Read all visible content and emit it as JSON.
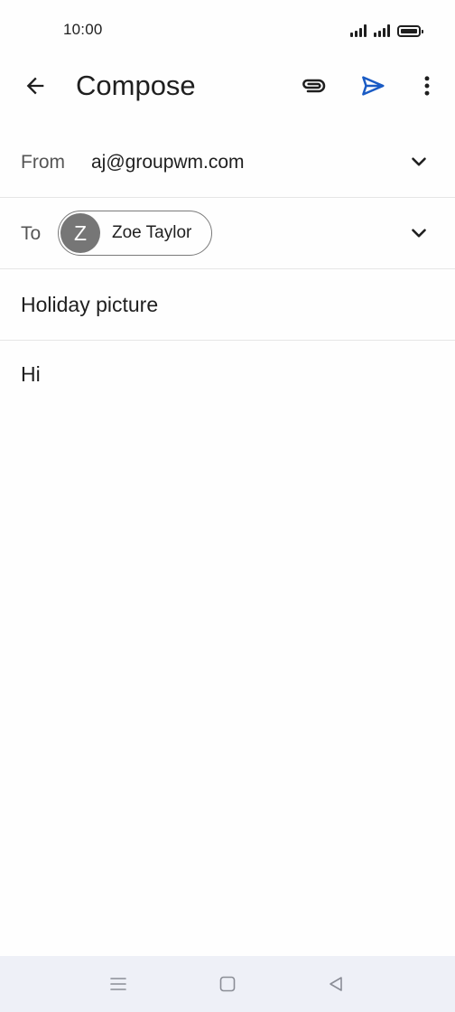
{
  "status_bar": {
    "time": "10:00",
    "icons": [
      "signal-icon",
      "signal-icon",
      "battery-icon"
    ]
  },
  "app_bar": {
    "title": "Compose",
    "icons": {
      "back": "arrow-back-icon",
      "attach": "paperclip-icon",
      "send": "send-icon",
      "more": "more-vert-icon"
    },
    "colors": {
      "send": "#1a5bc4"
    }
  },
  "compose": {
    "from_label": "From",
    "from_value": "aj@groupwm.com",
    "to_label": "To",
    "recipient": {
      "initial": "Z",
      "name": "Zoe Taylor",
      "avatar_color": "#767676"
    },
    "subject": "Holiday picture",
    "body": "Hi"
  },
  "nav_bar": {
    "icons": [
      "menu-icon",
      "home-square-icon",
      "back-triangle-icon"
    ]
  }
}
